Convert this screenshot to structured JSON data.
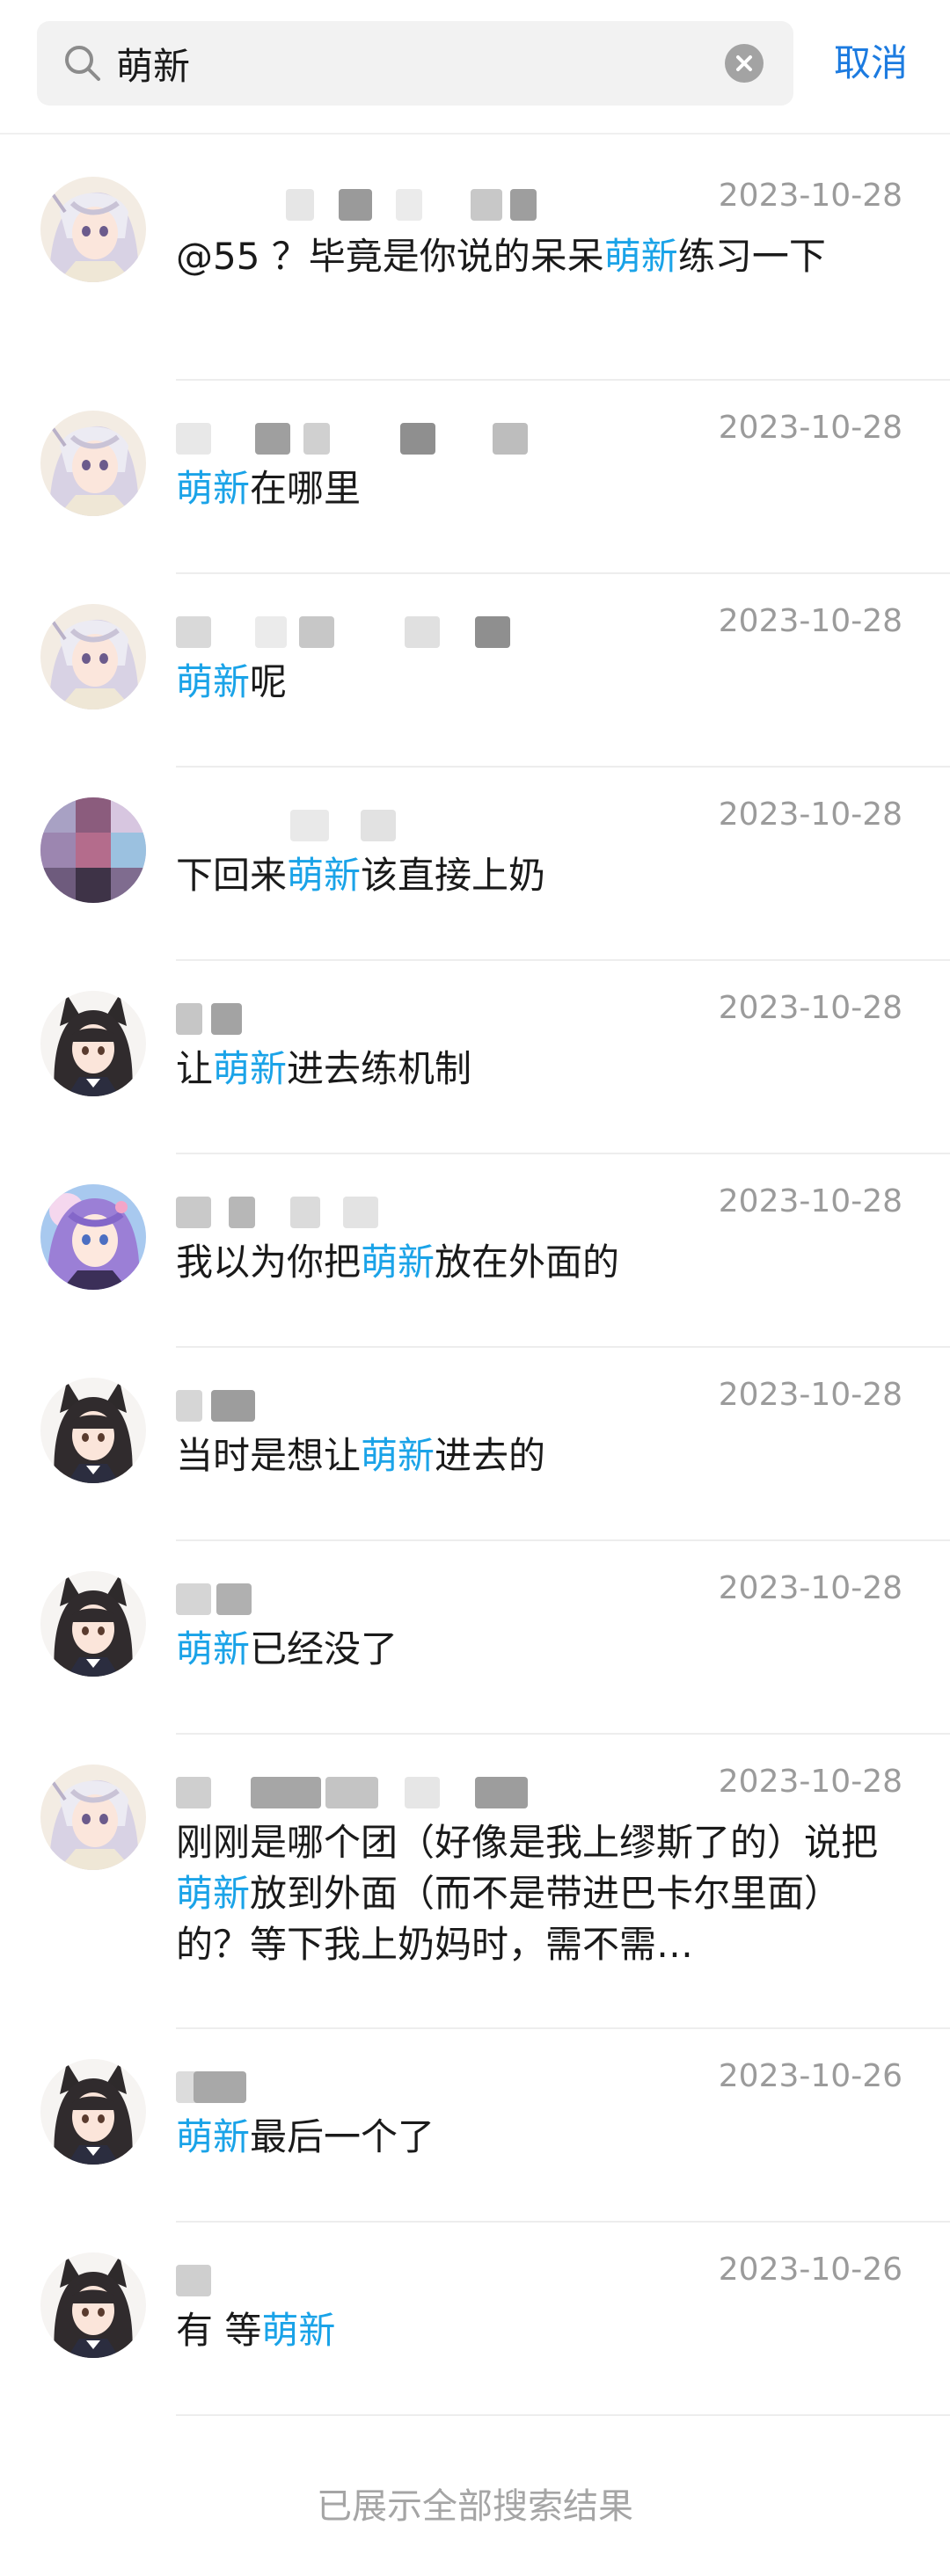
{
  "search": {
    "query": "萌新",
    "cancel_label": "取消"
  },
  "colors": {
    "accent": "#1c7be0",
    "highlight": "#1aa3e8",
    "date": "#9b9b9b",
    "search_bg": "#f2f2f2"
  },
  "results": [
    {
      "avatar": "avatar-white-hair",
      "date": "2023-10-28",
      "message": "@55 ？毕竟是你说的呆呆萌新练习一下",
      "highlight": "萌新"
    },
    {
      "avatar": "avatar-white-hair",
      "date": "2023-10-28",
      "message": "萌新在哪里",
      "highlight": "萌新"
    },
    {
      "avatar": "avatar-white-hair",
      "date": "2023-10-28",
      "message": "萌新呢",
      "highlight": "萌新"
    },
    {
      "avatar": "avatar-pixelated",
      "date": "2023-10-28",
      "message": "下回来萌新该直接上奶",
      "highlight": "萌新"
    },
    {
      "avatar": "avatar-cat-ears-girl",
      "date": "2023-10-28",
      "message": "让萌新进去练机制",
      "highlight": "萌新"
    },
    {
      "avatar": "avatar-purple-hair",
      "date": "2023-10-28",
      "message": "我以为你把萌新放在外面的",
      "highlight": "萌新"
    },
    {
      "avatar": "avatar-cat-ears-girl",
      "date": "2023-10-28",
      "message": "当时是想让萌新进去的",
      "highlight": "萌新"
    },
    {
      "avatar": "avatar-cat-ears-girl",
      "date": "2023-10-28",
      "message": "萌新已经没了",
      "highlight": "萌新"
    },
    {
      "avatar": "avatar-white-hair",
      "date": "2023-10-28",
      "message": "刚刚是哪个团（好像是我上缪斯了的）说把萌新放到外面（而不是带进巴卡尔里面）的？等下我上奶妈时，需不需…",
      "highlight": "萌新"
    },
    {
      "avatar": "avatar-cat-ears-girl",
      "date": "2023-10-26",
      "message": "萌新最后一个了",
      "highlight": "萌新"
    },
    {
      "avatar": "avatar-cat-ears-girl",
      "date": "2023-10-26",
      "message": "有 等萌新",
      "highlight": "萌新"
    }
  ],
  "footer": {
    "note": "已展示全部搜索结果"
  }
}
